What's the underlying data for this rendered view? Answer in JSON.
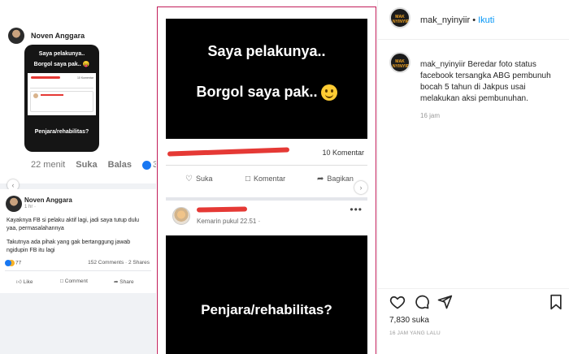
{
  "left_panel": {
    "post1": {
      "author": "Noven Anggara",
      "bubble": {
        "line1": "Saya pelakunya..",
        "line2": "Borgol saya pak.. 😛",
        "komentar": "10 Komentar",
        "footer": "Penjara/rehabilitas?"
      },
      "time": "22 menit",
      "like_label": "Suka",
      "reply_label": "Balas",
      "reaction_count": "3"
    },
    "post2": {
      "author": "Noven Anggara",
      "time": "1 hr ·",
      "text1": "Kayaknya FB si pelaku aktif lagi, jadi saya tutup dulu yaa, permasalahannya",
      "text2": "Takutnya ada pihak yang gak bertanggung jawab ngidupin FB itu lagi",
      "reactions": "77",
      "comments_shares": "152 Comments · 2 Shares",
      "like": "Like",
      "comment": "Comment",
      "share": "Share"
    }
  },
  "middle_panel": {
    "line1": "Saya pelakunya..",
    "line2": "Borgol saya pak..",
    "komentar_count": "10 Komentar",
    "suka": "Suka",
    "komentar": "Komentar",
    "bagikan": "Bagikan",
    "post_time": "Kemarin pukul 22.51 ·",
    "bottom_text": "Penjara/rehabilitas?",
    "dots": "•••"
  },
  "instagram": {
    "username": "mak_nyinyiir",
    "separator": "•",
    "follow": "Ikuti",
    "avatar_text": "MAK NYINYIR",
    "caption_user": "mak_nyinyiir",
    "caption": "Beredar foto status facebook tersangka ABG pembunuh bocah 5 tahun di Jakpus usai melakukan aksi pembunuhan.",
    "caption_age": "16 jam",
    "likes": "7,830 suka",
    "date": "16 JAM YANG LALU"
  },
  "colors": {
    "accent_border": "#c21e5a",
    "follow_blue": "#0095f6",
    "fb_blue": "#1877f2"
  }
}
